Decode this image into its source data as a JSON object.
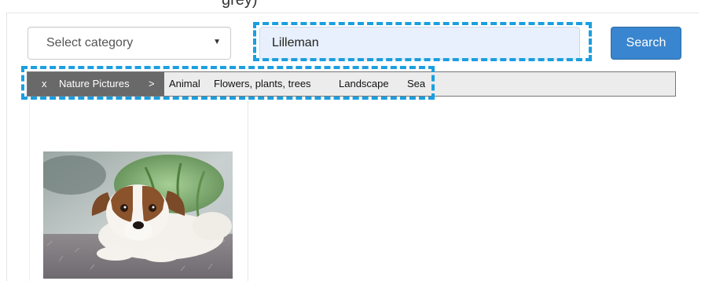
{
  "category_select": {
    "label": "Select category",
    "caret_icon": "caret-down-icon"
  },
  "search": {
    "value": "Lilleman",
    "button_label": "Search"
  },
  "category_bar": {
    "close_label": "x",
    "current_label": "Nature Pictures",
    "separator": ">",
    "subcategories": [
      "Animal",
      "Flowers, plants, trees",
      "Landscape",
      "Sea"
    ]
  },
  "results": [
    {
      "thumbnail": "dog-photo"
    }
  ],
  "colors": {
    "accent": "#3a85cf",
    "highlight": "#1a9fe0",
    "crumb_dark": "#696969",
    "input_bg": "#e8f0fd"
  }
}
